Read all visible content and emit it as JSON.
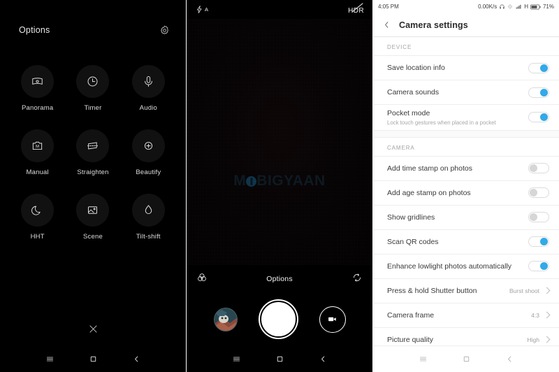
{
  "panels": {
    "options": {
      "title": "Options",
      "gear_icon": "gear-icon",
      "close_icon": "close-icon",
      "items": [
        {
          "label": "Panorama",
          "icon": "panorama-icon"
        },
        {
          "label": "Timer",
          "icon": "clock-icon"
        },
        {
          "label": "Audio",
          "icon": "microphone-icon"
        },
        {
          "label": "Manual",
          "icon": "manual-mode-icon"
        },
        {
          "label": "Straighten",
          "icon": "straighten-icon"
        },
        {
          "label": "Beautify",
          "icon": "beautify-icon"
        },
        {
          "label": "HHT",
          "icon": "moon-icon"
        },
        {
          "label": "Scene",
          "icon": "image-icon"
        },
        {
          "label": "Tilt-shift",
          "icon": "water-drop-icon"
        }
      ]
    },
    "viewfinder": {
      "flash_label": "A",
      "flash_icon": "flash-auto-icon",
      "hdr_label": "HDR",
      "hdr_icon": "hdr-off-icon",
      "watermark_before": "M",
      "watermark_after": "BIGYAAN",
      "mode_label": "Options",
      "filter_icon": "color-filter-icon",
      "switch_camera_icon": "switch-camera-icon",
      "gallery_thumb_icon": "gallery-thumbnail",
      "shutter_icon": "shutter-button",
      "video_icon": "video-camera-icon"
    },
    "settings": {
      "statusbar": {
        "time": "4:05 PM",
        "network_speed": "0.00K/s",
        "headphone_icon": "headphone-icon",
        "vibrate_icon": "vibrate-icon",
        "signal_icon": "signal-bars-icon",
        "network_type": "H",
        "battery_icon": "battery-icon",
        "battery_percent": "71%"
      },
      "header": {
        "back_icon": "back-chevron-icon",
        "title": "Camera settings"
      },
      "sections": [
        {
          "name": "DEVICE",
          "rows": [
            {
              "label": "Save location info",
              "sub": "",
              "control": "toggle",
              "state": "on",
              "value": ""
            },
            {
              "label": "Camera sounds",
              "sub": "",
              "control": "toggle",
              "state": "on",
              "value": ""
            },
            {
              "label": "Pocket mode",
              "sub": "Lock touch gestures when placed in a pocket",
              "control": "toggle",
              "state": "on",
              "value": ""
            }
          ]
        },
        {
          "name": "CAMERA",
          "rows": [
            {
              "label": "Add time stamp on photos",
              "sub": "",
              "control": "toggle",
              "state": "off",
              "value": ""
            },
            {
              "label": "Add age stamp on photos",
              "sub": "",
              "control": "toggle",
              "state": "off",
              "value": ""
            },
            {
              "label": "Show gridlines",
              "sub": "",
              "control": "toggle",
              "state": "off",
              "value": ""
            },
            {
              "label": "Scan QR codes",
              "sub": "",
              "control": "toggle",
              "state": "on",
              "value": ""
            },
            {
              "label": "Enhance lowlight photos automatically",
              "sub": "",
              "control": "toggle",
              "state": "on",
              "value": ""
            },
            {
              "label": "Press & hold Shutter button",
              "sub": "",
              "control": "chevron",
              "state": "",
              "value": "Burst shoot"
            },
            {
              "label": "Camera frame",
              "sub": "",
              "control": "chevron",
              "state": "",
              "value": "4:3"
            },
            {
              "label": "Picture quality",
              "sub": "",
              "control": "chevron",
              "state": "",
              "value": "High"
            }
          ]
        }
      ]
    }
  },
  "navbar": {
    "menu_icon": "menu-icon",
    "home_icon": "home-icon",
    "back_icon": "back-icon"
  },
  "colors": {
    "accent": "#33a9e8",
    "toggle_off": "#d6d6d6",
    "panel_bg_dark": "#000000",
    "panel_bg_light": "#ffffff"
  }
}
